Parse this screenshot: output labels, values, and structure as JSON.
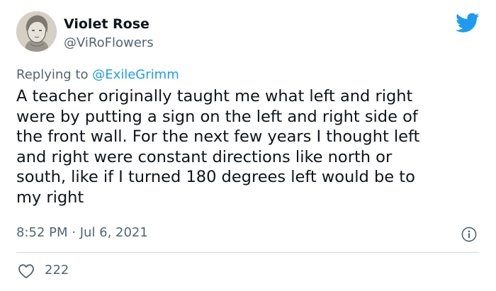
{
  "author": {
    "display_name": "Violet Rose",
    "handle": "@ViRoFlowers"
  },
  "reply": {
    "prefix": "Replying to ",
    "mention": "@ExileGrimm"
  },
  "tweet": {
    "text": "A teacher originally taught me what left and right\nwere by putting a sign on the left and right side of\nthe front wall. For the next few years I thought left\nand right were constant directions like north or\nsouth, like if I turned 180 degrees left would be to\nmy right",
    "timestamp": "8:52 PM · Jul 6, 2021",
    "like_count": "222"
  },
  "icons": {
    "brand": "twitter-bird-icon",
    "info": "info-icon",
    "like": "heart-icon"
  },
  "colors": {
    "brand_blue": "#1d9bf0",
    "secondary_text": "#536471",
    "primary_text": "#0f1419",
    "divider": "#cfd9de"
  }
}
